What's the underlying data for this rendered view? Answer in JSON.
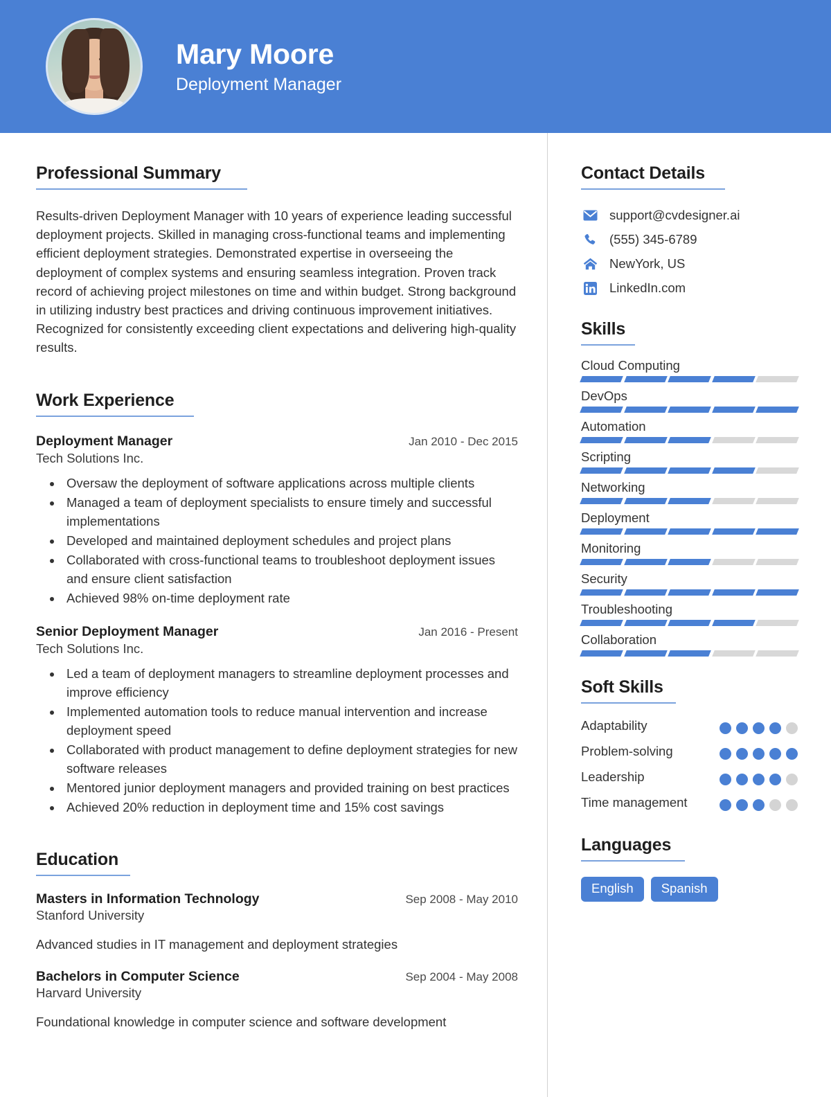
{
  "colors": {
    "accent": "#4a80d4",
    "rule": "#7aa2dd",
    "track": "#d8d8d8",
    "text": "#333333",
    "divider": "#d2d2d2"
  },
  "header": {
    "name": "Mary Moore",
    "role": "Deployment Manager",
    "avatar_alt": "profile-photo"
  },
  "main": {
    "summary": {
      "heading": "Professional Summary",
      "text": "Results-driven Deployment Manager with 10 years of experience leading successful deployment projects. Skilled in managing cross-functional teams and implementing efficient deployment strategies. Demonstrated expertise in overseeing the deployment of complex systems and ensuring seamless integration. Proven track record of achieving project milestones on time and within budget. Strong background in utilizing industry best practices and driving continuous improvement initiatives. Recognized for consistently exceeding client expectations and delivering high-quality results."
    },
    "work": {
      "heading": "Work Experience",
      "jobs": [
        {
          "title": "Deployment Manager",
          "dates": "Jan 2010 - Dec 2015",
          "company": "Tech Solutions Inc.",
          "bullets": [
            "Oversaw the deployment of software applications across multiple clients",
            "Managed a team of deployment specialists to ensure timely and successful implementations",
            "Developed and maintained deployment schedules and project plans",
            "Collaborated with cross-functional teams to troubleshoot deployment issues and ensure client satisfaction",
            "Achieved 98% on-time deployment rate"
          ]
        },
        {
          "title": "Senior Deployment Manager",
          "dates": "Jan 2016 - Present",
          "company": "Tech Solutions Inc.",
          "bullets": [
            "Led a team of deployment managers to streamline deployment processes and improve efficiency",
            "Implemented automation tools to reduce manual intervention and increase deployment speed",
            "Collaborated with product management to define deployment strategies for new software releases",
            "Mentored junior deployment managers and provided training on best practices",
            "Achieved 20% reduction in deployment time and 15% cost savings"
          ]
        }
      ]
    },
    "education": {
      "heading": "Education",
      "entries": [
        {
          "degree": "Masters in Information Technology",
          "dates": "Sep 2008 - May 2010",
          "school": "Stanford University",
          "description": "Advanced studies in IT management and deployment strategies"
        },
        {
          "degree": "Bachelors in Computer Science",
          "dates": "Sep 2004 - May 2008",
          "school": "Harvard University",
          "description": "Foundational knowledge in computer science and software development"
        }
      ]
    }
  },
  "sidebar": {
    "contact": {
      "heading": "Contact Details",
      "items": [
        {
          "icon": "envelope-icon",
          "value": "support@cvdesigner.ai"
        },
        {
          "icon": "phone-icon",
          "value": "(555) 345-6789"
        },
        {
          "icon": "home-icon",
          "value": "NewYork, US"
        },
        {
          "icon": "linkedin-icon",
          "value": "LinkedIn.com"
        }
      ]
    },
    "skills": {
      "heading": "Skills",
      "max": 5,
      "items": [
        {
          "name": "Cloud Computing",
          "level": 4
        },
        {
          "name": "DevOps",
          "level": 5
        },
        {
          "name": "Automation",
          "level": 3
        },
        {
          "name": "Scripting",
          "level": 4
        },
        {
          "name": "Networking",
          "level": 3
        },
        {
          "name": "Deployment",
          "level": 5
        },
        {
          "name": "Monitoring",
          "level": 3
        },
        {
          "name": "Security",
          "level": 5
        },
        {
          "name": "Troubleshooting",
          "level": 4
        },
        {
          "name": "Collaboration",
          "level": 3
        }
      ]
    },
    "soft_skills": {
      "heading": "Soft Skills",
      "max": 5,
      "items": [
        {
          "name": "Adaptability",
          "level": 4
        },
        {
          "name": "Problem-solving",
          "level": 5
        },
        {
          "name": "Leadership",
          "level": 4
        },
        {
          "name": "Time management",
          "level": 3
        }
      ]
    },
    "languages": {
      "heading": "Languages",
      "items": [
        "English",
        "Spanish"
      ]
    }
  }
}
